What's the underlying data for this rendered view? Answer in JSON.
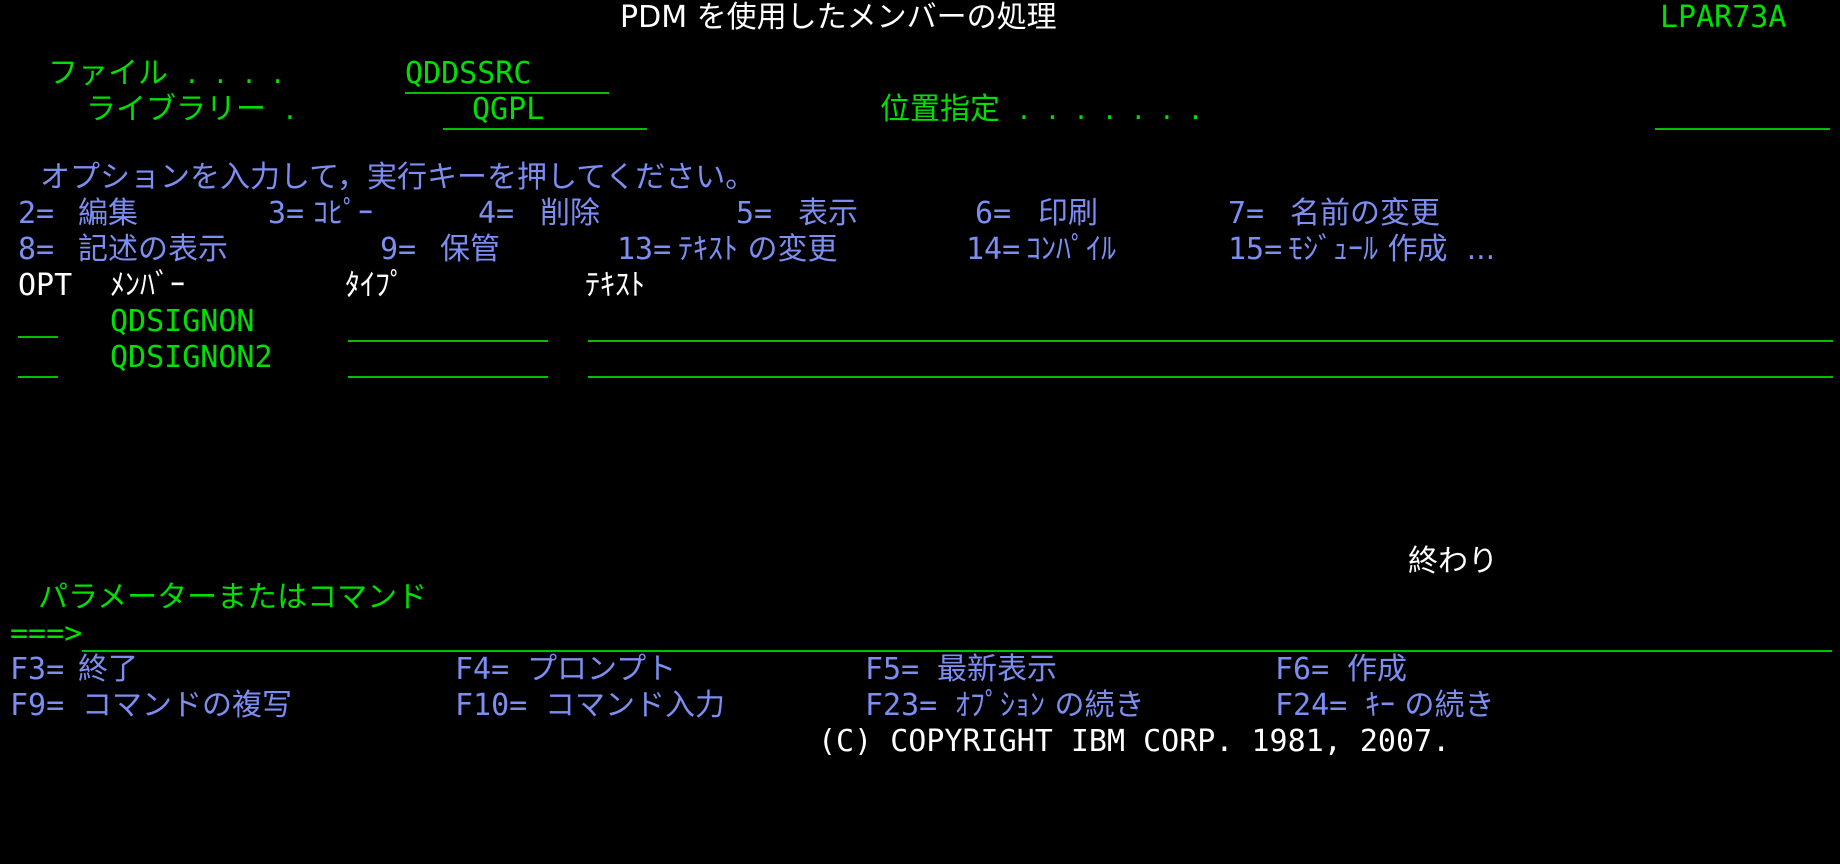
{
  "screen": {
    "type": "ibm-i-5250-terminal",
    "columns": 80,
    "rows": 24,
    "colors": {
      "background": "#000000",
      "green": "#00e000",
      "white": "#ffffff",
      "blue": "#7d8ef2"
    }
  },
  "header": {
    "title": "PDM を使用したメンバーの処理",
    "system_name": "LPAR73A"
  },
  "file_info": {
    "file_label": "ファイル  .  .  .  .",
    "file_value": "QDDSSRC",
    "library_label": "ライブラリー  .",
    "library_value": "QGPL",
    "position_label": "位置指定  .  .  .  .  .  .  .",
    "position_value": ""
  },
  "instructions": {
    "prompt": "オプションを入力して，実行キーを押してください。",
    "options_line1": [
      {
        "code": "2=",
        "label": "編集"
      },
      {
        "code": "3=",
        "label": "ｺﾋﾟｰ"
      },
      {
        "code": "4=",
        "label": "削除"
      },
      {
        "code": "5=",
        "label": "表示"
      },
      {
        "code": "6=",
        "label": "印刷"
      },
      {
        "code": "7=",
        "label": "名前の変更"
      }
    ],
    "options_line2": [
      {
        "code": "8=",
        "label": "記述の表示"
      },
      {
        "code": "9=",
        "label": "保管"
      },
      {
        "code": "13=",
        "label": "ﾃｷｽﾄ の変更"
      },
      {
        "code": "14=",
        "label": "ｺﾝﾊﾟｲﾙ"
      },
      {
        "code": "15=",
        "label": "ﾓｼﾞｭｰﾙ 作成  ..."
      }
    ]
  },
  "table": {
    "headers": {
      "opt": "OPT",
      "member": "ﾒﾝﾊﾞｰ",
      "type": "ﾀｲﾌﾟ",
      "text": "ﾃｷｽﾄ"
    },
    "rows": [
      {
        "opt": "",
        "member": "QDSIGNON",
        "type": "",
        "text": ""
      },
      {
        "opt": "",
        "member": "QDSIGNON2",
        "type": "",
        "text": ""
      }
    ],
    "end_marker": "終わり"
  },
  "command_area": {
    "label": "パラメーターまたはコマンド",
    "prompt": "===>",
    "value": ""
  },
  "function_keys": {
    "line1": [
      {
        "key": "F3=",
        "label": "終了"
      },
      {
        "key": "F4=",
        "label": "プロンプト"
      },
      {
        "key": "F5=",
        "label": "最新表示"
      },
      {
        "key": "F6=",
        "label": "作成"
      }
    ],
    "line2": [
      {
        "key": "F9=",
        "label": "コマンドの複写"
      },
      {
        "key": "F10=",
        "label": "コマンド入力"
      },
      {
        "key": "F23=",
        "label": "ｵﾌﾟｼｮﾝ の続き"
      },
      {
        "key": "F24=",
        "label": "ｷｰ の続き"
      }
    ]
  },
  "copyright": "(C) COPYRIGHT IBM CORP. 1981, 2007."
}
